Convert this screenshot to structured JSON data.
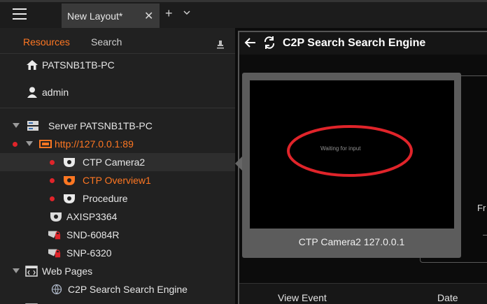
{
  "topbar": {
    "layout_tab": "New Layout*",
    "close_glyph": "✕",
    "add_glyph": "+"
  },
  "resources": {
    "tab_resources": "Resources",
    "tab_search": "Search",
    "pc_name": "PATSNB1TB-PC",
    "user": "admin",
    "server": "Server PATSNB1TB-PC",
    "server_url": "http://127.0.0.1:89",
    "cameras": [
      "CTP Camera2",
      "CTP Overview1",
      "Procedure"
    ],
    "devices": [
      "AXISP3364",
      "SND-6084R",
      "SNP-6320"
    ],
    "web_pages": "Web Pages",
    "web_page_item": "C2P Search Search Engine",
    "colors": {
      "accent": "#ff7722",
      "alert": "#e0242a"
    }
  },
  "viewer": {
    "title": "C2P Search Search Engine",
    "partial_label": "Fr",
    "col_view_event": "View Event",
    "col_date": "Date"
  },
  "tooltip": {
    "waiting_text": "Waiting for input",
    "caption": "CTP Camera2 127.0.0.1"
  }
}
